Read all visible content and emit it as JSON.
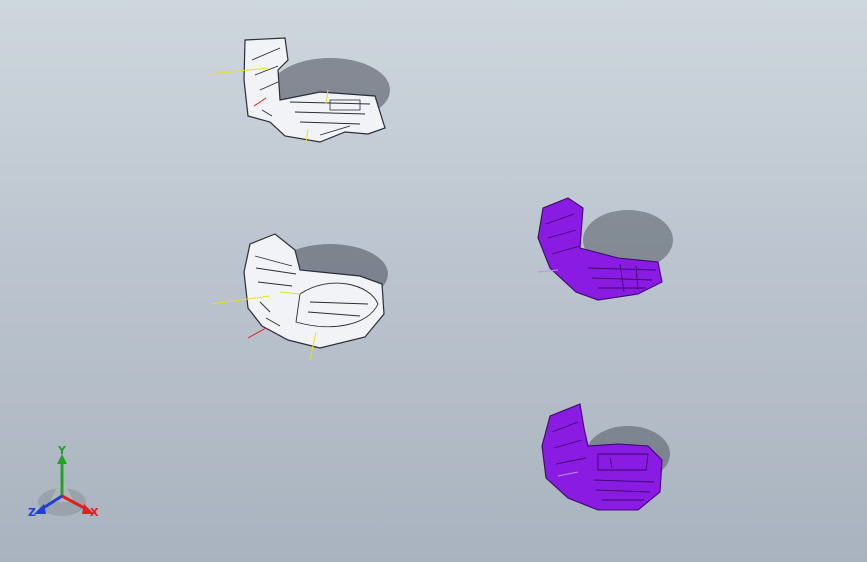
{
  "viewport": {
    "background_top": "#cfd6de",
    "background_bottom": "#a9b3bf"
  },
  "parts": [
    {
      "name": "part-white-1",
      "color": "#f2f3f7",
      "edge": "#2a2d3a"
    },
    {
      "name": "part-white-2",
      "color": "#f2f3f7",
      "edge": "#2a2d3a"
    },
    {
      "name": "part-purple-1",
      "color": "#8a1be2",
      "edge": "#3b0a6a"
    },
    {
      "name": "part-purple-2",
      "color": "#8a1be2",
      "edge": "#3b0a6a"
    }
  ],
  "triad": {
    "x_label": "X",
    "y_label": "Y",
    "z_label": "Z",
    "x_color": "#e01f1f",
    "y_color": "#1fa51f",
    "z_color": "#1f3fd6"
  }
}
